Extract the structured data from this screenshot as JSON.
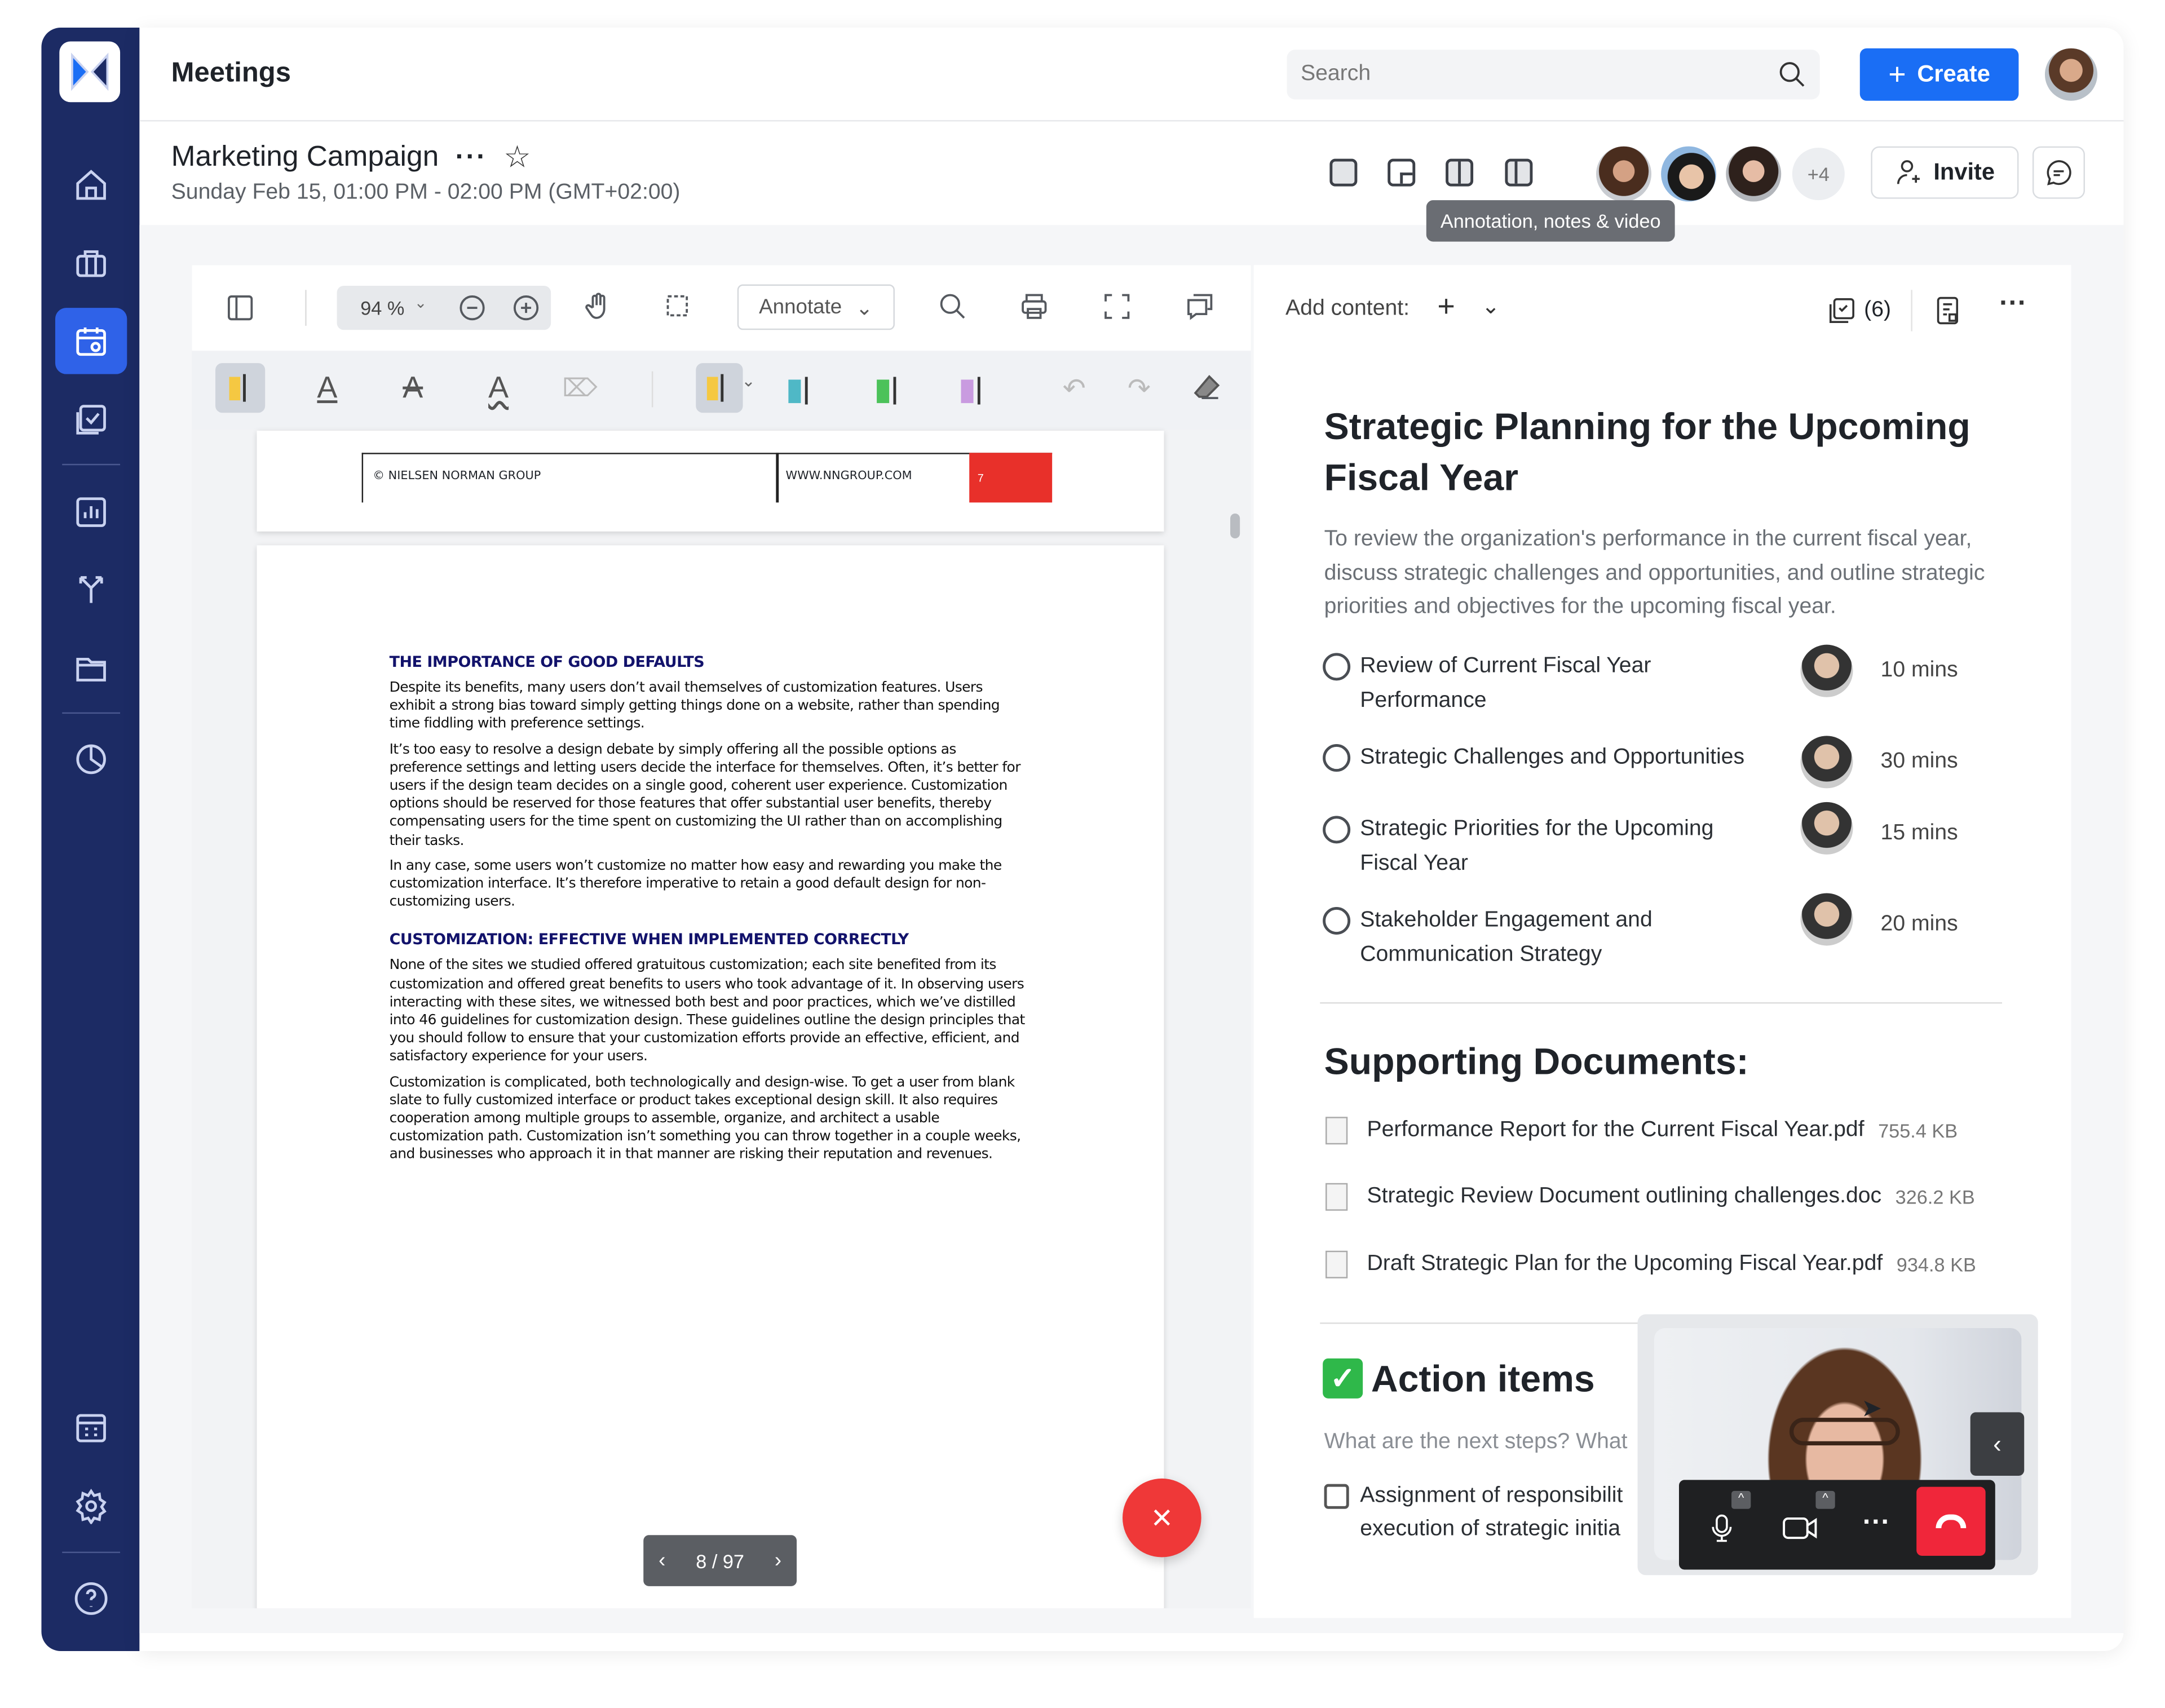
{
  "app": {
    "title": "Meetings",
    "search_placeholder": "Search",
    "create_label": "Create"
  },
  "sidebar": {
    "items": [
      {
        "icon": "home-icon"
      },
      {
        "icon": "briefcase-icon"
      },
      {
        "icon": "calendar-icon",
        "active": true
      },
      {
        "icon": "tasks-icon"
      },
      {
        "icon": "chart-icon"
      },
      {
        "icon": "branch-icon"
      },
      {
        "icon": "folder-icon"
      },
      {
        "icon": "pie-chart-icon"
      },
      {
        "icon": "building-icon"
      },
      {
        "icon": "gear-icon"
      },
      {
        "icon": "help-icon"
      }
    ]
  },
  "meeting": {
    "title": "Marketing Campaign",
    "date": "Sunday Feb 15, 01:00 PM - 02:00 PM (GMT+02:00)",
    "extra_participants": "+4",
    "invite_label": "Invite",
    "tooltip": "Annotation, notes & video"
  },
  "viewer": {
    "zoom": "94 %",
    "mode": "Annotate",
    "page_indicator": "8 / 97",
    "footer": {
      "left": "© NIELSEN NORMAN GROUP",
      "mid": "WWW.NNGROUP.COM",
      "num": "7"
    },
    "highlight_colors": [
      "#f5c842",
      "#4fb8c6",
      "#4cc25a",
      "#c99be0"
    ],
    "sections": [
      {
        "heading": "THE IMPORTANCE OF GOOD DEFAULTS",
        "paragraphs": [
          "Despite its benefits, many users don’t avail themselves of customization features. Users exhibit a strong bias toward simply getting things done on a website, rather than spending time fiddling with preference settings.",
          "It’s too easy to resolve a design debate by simply offering all the possible options as preference settings and letting users decide the interface for themselves. Often, it’s better for users if the design team decides on a single good, coherent user experience. Customization options should be reserved for those features that offer substantial user benefits, thereby compensating users for the time spent on customizing the UI rather than on accomplishing their tasks.",
          "In any case, some users won’t customize no matter how easy and rewarding you make the customization interface. It’s therefore imperative to retain a good default design for non-customizing users."
        ]
      },
      {
        "heading": "CUSTOMIZATION: EFFECTIVE WHEN IMPLEMENTED CORRECTLY",
        "paragraphs": [
          "None of the sites we studied offered gratuitous customization; each site benefited from its customization and offered great benefits to users who took advantage of it. In observing users interacting with these sites, we witnessed both best and poor practices, which we’ve distilled into 46 guidelines for customization design. These guidelines outline the design principles that you should follow to ensure that your customization efforts provide an effective, efficient, and satisfactory experience for your users.",
          "Customization is complicated, both technologically and design-wise. To get a user from blank slate to fully customized interface or product takes exceptional design skill. It also requires cooperation among multiple groups to assemble, organize, and architect a usable customization path. Customization isn’t something you can throw together in a couple weeks, and businesses who approach it in that manner are risking their reputation and revenues."
        ]
      }
    ]
  },
  "notes": {
    "add_content_label": "Add content:",
    "task_count": "(6)",
    "title": "Strategic  Planning for the Upcoming Fiscal Year",
    "description": "To review the organization's performance in the current fiscal year, discuss strategic challenges and opportunities, and outline strategic priorities and objectives for the upcoming fiscal year.",
    "agenda": [
      {
        "text": "Review of Current Fiscal Year Performance",
        "duration": "10 mins"
      },
      {
        "text": "Strategic Challenges and Opportunities",
        "duration": "30 mins"
      },
      {
        "text": "Strategic Priorities for the Upcoming Fiscal Year",
        "duration": "15 mins"
      },
      {
        "text": "Stakeholder Engagement and Communication Strategy",
        "duration": "20 mins"
      }
    ],
    "docs_heading": "Supporting Documents:",
    "docs": [
      {
        "name": "Performance Report for the Current Fiscal Year.pdf",
        "size": "755.4 KB"
      },
      {
        "name": "Strategic Review Document outlining challenges.doc",
        "size": "326.2 KB"
      },
      {
        "name": "Draft Strategic Plan for the Upcoming Fiscal Year.pdf",
        "size": "934.8 KB"
      }
    ],
    "action_heading": "Action items",
    "action_placeholder": "What are the next steps? What",
    "action_item": "Assignment of responsibilit execution of strategic initia"
  },
  "colors": {
    "sidebar": "#1c2b64",
    "accent": "#1a6ef5",
    "end_call": "#f0263a"
  }
}
